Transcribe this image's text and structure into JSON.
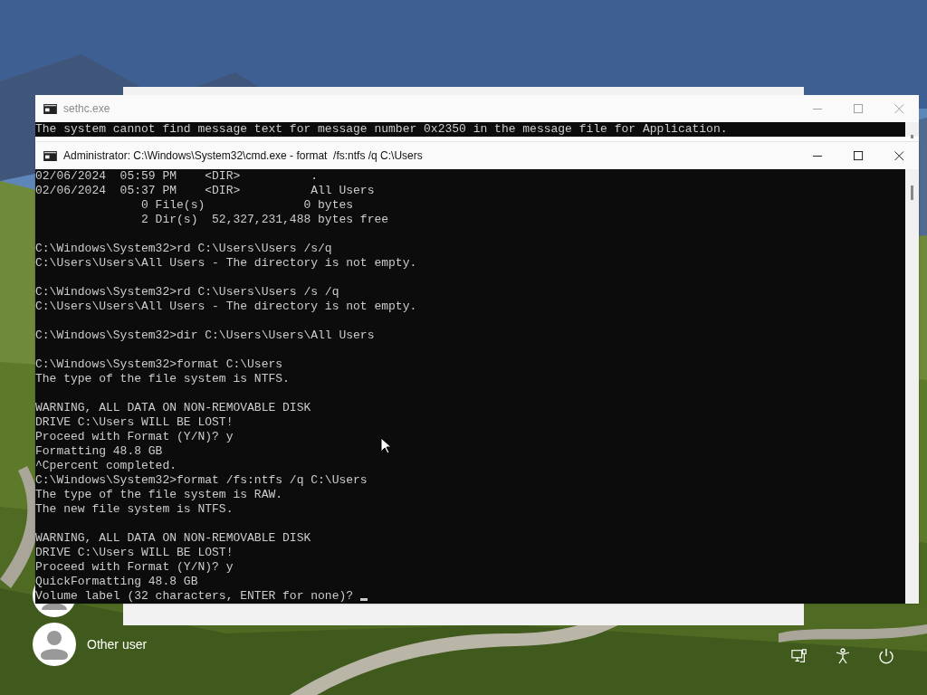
{
  "windows": [
    {
      "title": "sethc.exe",
      "active": false,
      "paragraphs": [
        [
          "The system cannot find message text for message number 0x2350 in the message file for Application."
        ]
      ],
      "cursor": false
    },
    {
      "title": "Administrator: C:\\Windows\\System32\\cmd.exe - format  /fs:ntfs /q C:\\Users",
      "active": true,
      "paragraphs": [
        [
          "02/06/2024  05:59 PM    <DIR>          .",
          "02/06/2024  05:37 PM    <DIR>          All Users",
          "               0 File(s)              0 bytes",
          "               2 Dir(s)  52,327,231,488 bytes free"
        ],
        [
          "C:\\Windows\\System32>rd C:\\Users\\Users /s/q",
          "C:\\Users\\Users\\All Users - The directory is not empty."
        ],
        [
          "C:\\Windows\\System32>rd C:\\Users\\Users /s /q",
          "C:\\Users\\Users\\All Users - The directory is not empty."
        ],
        [
          "C:\\Windows\\System32>dir C:\\Users\\Users\\All Users"
        ],
        [
          "C:\\Windows\\System32>format C:\\Users",
          "The type of the file system is NTFS."
        ],
        [
          "WARNING, ALL DATA ON NON-REMOVABLE DISK",
          "DRIVE C:\\Users WILL BE LOST!",
          "Proceed with Format (Y/N)? y",
          "Formatting 48.8 GB",
          "^Cpercent completed.",
          "C:\\Windows\\System32>format /fs:ntfs /q C:\\Users",
          "The type of the file system is RAW.",
          "The new file system is NTFS."
        ],
        [
          "WARNING, ALL DATA ON NON-REMOVABLE DISK",
          "DRIVE C:\\Users WILL BE LOST!",
          "Proceed with Format (Y/N)? y",
          "QuickFormatting 48.8 GB",
          "Volume label (32 characters, ENTER for none)?"
        ]
      ],
      "cursor": true
    }
  ],
  "users": [
    {
      "name": "Other user"
    }
  ]
}
